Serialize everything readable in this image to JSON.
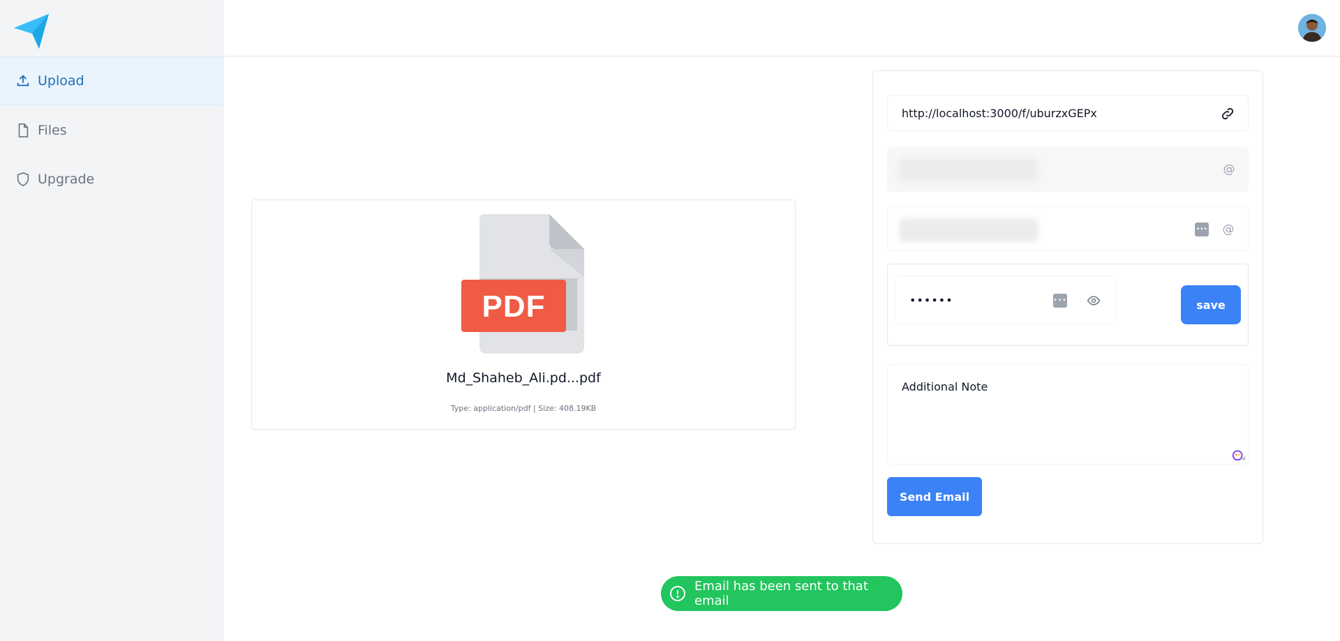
{
  "sidebar": {
    "items": [
      {
        "label": "Upload",
        "icon": "upload-icon",
        "active": true
      },
      {
        "label": "Files",
        "icon": "file-icon",
        "active": false
      },
      {
        "label": "Upgrade",
        "icon": "shield-icon",
        "active": false
      }
    ]
  },
  "header": {
    "avatar": "user-avatar"
  },
  "preview": {
    "icon_label": "PDF",
    "file_name": "Md_Shaheb_Ali.pd...pdf",
    "file_meta": "Type: application/pdf | Size: 408.19KB"
  },
  "form": {
    "url": "http://localhost:3000/f/uburzxGEPx",
    "password_value": "••••••",
    "save_label": "save",
    "note_label": "Additional Note",
    "send_label": "Send Email"
  },
  "toast": {
    "message": "Email has been sent to that email"
  },
  "colors": {
    "accent": "#3b82f6",
    "success": "#22c55e",
    "pdf_red": "#ef5b45",
    "active_nav": "#1e6fb5"
  }
}
